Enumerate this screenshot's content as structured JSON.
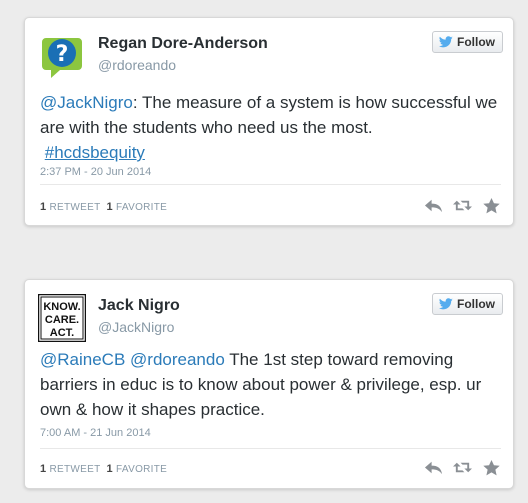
{
  "tweets": [
    {
      "name": "Regan Dore-Anderson",
      "handle": "@rdoreando",
      "follow_label": "Follow",
      "avatar_icon": "question-bubble-icon",
      "text_parts": [
        {
          "text": "@JackNigro",
          "type": "mention"
        },
        {
          "text": ": The measure of a system is how successful we are with the students who need us the most.",
          "type": "text"
        },
        {
          "text": "#hcdsbequity",
          "type": "hashtag"
        }
      ],
      "timestamp": "2:37 PM - 20 Jun 2014",
      "retweets_count": "1",
      "retweets_label": "RETWEET",
      "favorites_count": "1",
      "favorites_label": "FAVORITE"
    },
    {
      "name": "Jack Nigro",
      "handle": "@JackNigro",
      "follow_label": "Follow",
      "avatar_text": [
        "KNOW.",
        "CARE.",
        "ACT."
      ],
      "text_parts": [
        {
          "text": "@RaineCB",
          "type": "mention"
        },
        {
          "text": "@rdoreando",
          "type": "mention"
        },
        {
          "text": "The 1st step toward removing barriers in educ is to know about power & privilege, esp. ur own & how it shapes practice.",
          "type": "text"
        }
      ],
      "timestamp": "7:00 AM - 21 Jun 2014",
      "retweets_count": "1",
      "retweets_label": "RETWEET",
      "favorites_count": "1",
      "favorites_label": "FAVORITE"
    }
  ],
  "colors": {
    "link": "#2b7bb9",
    "muted": "#8899a6",
    "twitter_blue": "#55acee",
    "avatar_green": "#8cc63f"
  }
}
